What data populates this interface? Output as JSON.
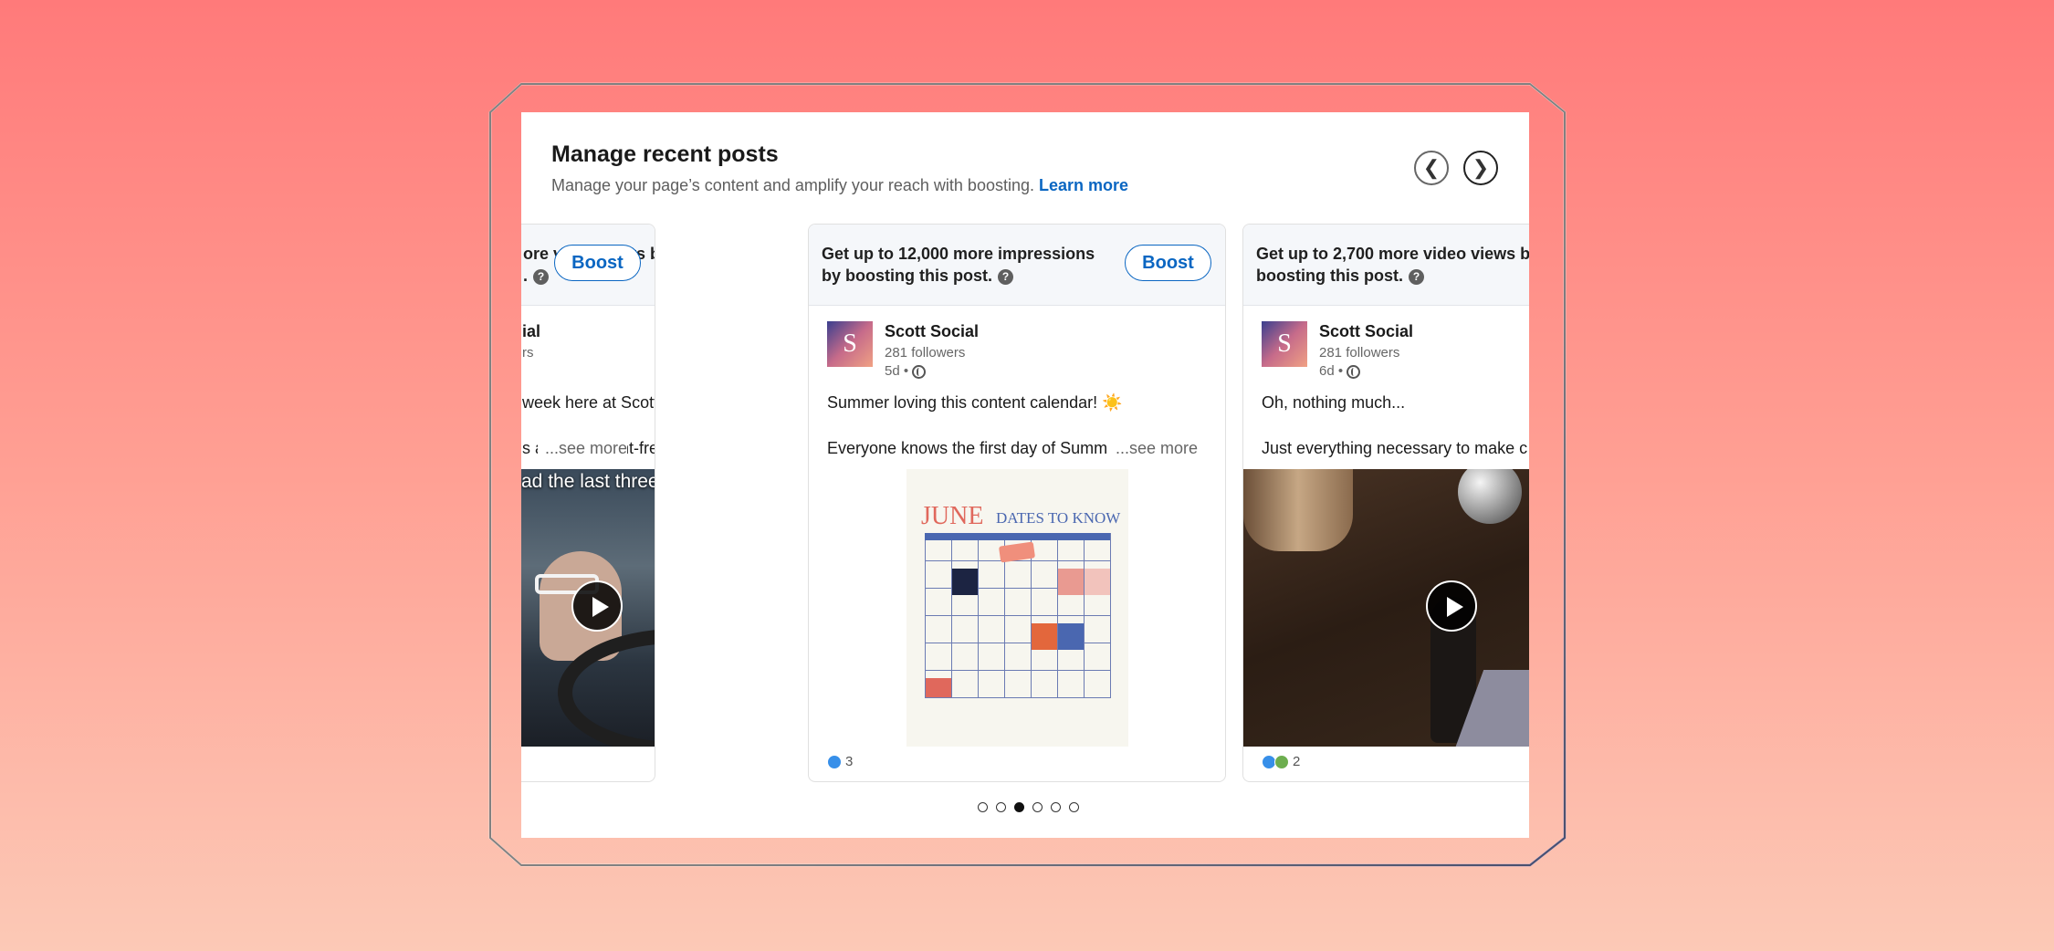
{
  "header": {
    "title": "Manage recent posts",
    "subtitle": "Manage your page’s content and amplify your reach with boosting.",
    "learn_more": "Learn more",
    "prev_icon": "chevron-left-icon",
    "next_icon": "chevron-right-icon"
  },
  "cards": [
    {
      "promo": "ore video views by ",
      "promo_line2": ".",
      "boost_label": "Boost",
      "author": "ial",
      "followers": "rs",
      "meta": "",
      "text_line1": " week here at Scott Social! ✨",
      "text_line2": "s are living rent-free",
      "see_more": "...see more",
      "media_caption": "ad the last three days?",
      "reactions": ""
    },
    {
      "promo": "Get up to 12,000 more impressions",
      "promo_line2": "by boosting this post.",
      "boost_label": "Boost",
      "avatar_letter": "S",
      "author": "Scott Social",
      "followers": "281 followers",
      "meta": "5d •",
      "text_line1": "Summer loving this content calendar! ☀️",
      "text_line2": "Everyone knows the first day of Summ",
      "see_more": "...see more",
      "calendar_month": "JUNE",
      "calendar_title": "DATES TO KNOW",
      "reactions": "3"
    },
    {
      "promo": "Get up to 2,700 more video views b",
      "promo_line2": "boosting this post.",
      "avatar_letter": "S",
      "author": "Scott Social",
      "followers": "281 followers",
      "meta": "6d •",
      "text_line1": "Oh, nothing much...",
      "text_line2": "Just everything necessary to make c",
      "reactions": "2"
    }
  ],
  "pagination": {
    "total": 6,
    "active_index": 2
  },
  "colors": {
    "accent": "#0a66c2",
    "background_top": "#ff7a7a",
    "background_bottom": "#fcc9b6"
  }
}
